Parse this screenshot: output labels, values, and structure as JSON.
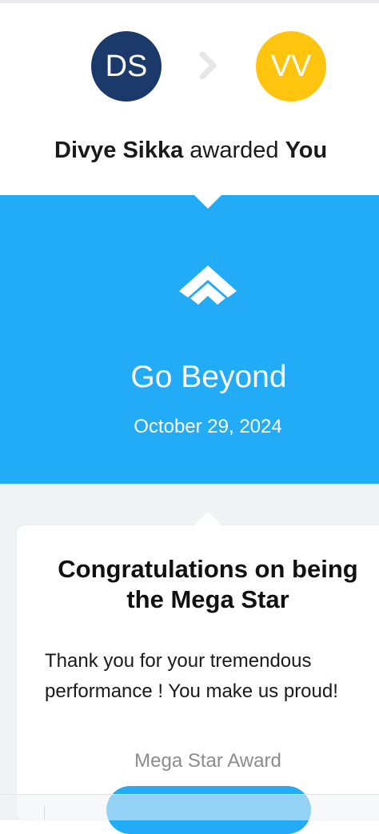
{
  "sender": {
    "initials": "DS",
    "name": "Divye Sikka",
    "color": "#1b3a6b"
  },
  "recipient": {
    "initials": "VV",
    "name": "You",
    "color": "#ffc40e"
  },
  "award_verb": "awarded",
  "award": {
    "name": "Go Beyond",
    "date": "October 29, 2024",
    "icon": "chevron-up-icon",
    "band_color": "#22abf7"
  },
  "card": {
    "title": "Congratulations on being the Mega Star",
    "message": "Thank you for your tremendous performance ! You make us proud!",
    "award_label": "Mega Star Award"
  },
  "icons": {
    "arrow": "chevron-right-icon"
  }
}
